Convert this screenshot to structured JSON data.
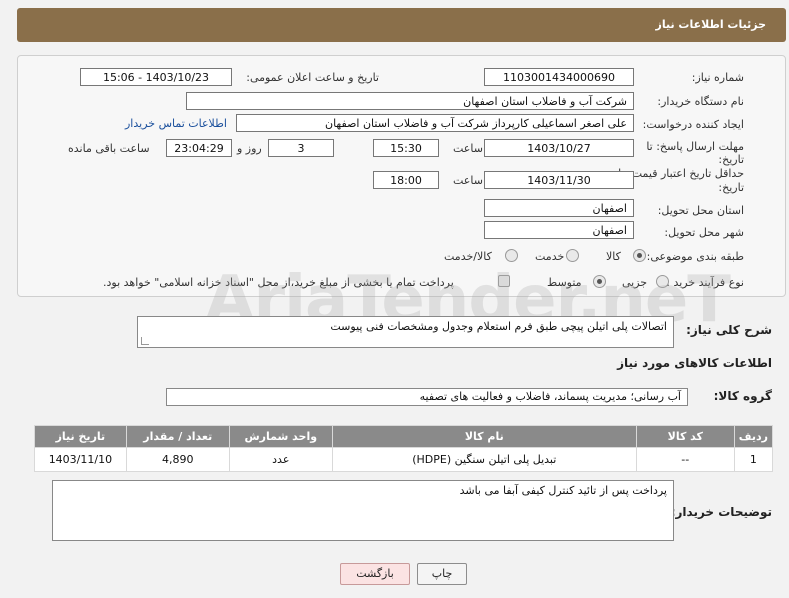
{
  "header": {
    "title": "جزئیات اطلاعات نیاز"
  },
  "form": {
    "need_number_label": "شماره نیاز:",
    "need_number": "1103001434000690",
    "announce_label": "تاریخ و ساعت اعلان عمومی:",
    "announce_value": "1403/10/23 - 15:06",
    "buyer_org_label": "نام دستگاه خریدار:",
    "buyer_org": "شرکت آب و فاضلاب استان اصفهان",
    "creator_label": "ایجاد کننده درخواست:",
    "creator": "علی اصغر اسماعیلی کارپرداز شرکت آب و فاضلاب استان اصفهان",
    "buyer_contact_link": "اطلاعات تماس خریدار",
    "deadline_label_1": "مهلت ارسال پاسخ: تا",
    "deadline_label_2": "تاریخ:",
    "deadline_date": "1403/10/27",
    "time_label": "ساعت",
    "deadline_time": "15:30",
    "days_value": "3",
    "days_and_label": "روز و",
    "remaining_time": "23:04:29",
    "remaining_label": "ساعت باقی مانده",
    "price_valid_label_1": "حداقل تاریخ اعتبار قیمت: تا",
    "price_valid_label_2": "تاریخ:",
    "price_valid_date": "1403/11/30",
    "price_valid_time": "18:00",
    "province_label": "استان محل تحویل:",
    "province": "اصفهان",
    "city_label": "شهر محل تحویل:",
    "city": "اصفهان",
    "category_label": "طبقه بندی موضوعی:",
    "category_options": [
      "کالا",
      "خدمت",
      "کالا/خدمت"
    ],
    "process_label": "نوع فرآیند خرید :",
    "process_options": [
      "جزیی",
      "متوسط"
    ],
    "payment_note": "پرداخت تمام یا بخشی از مبلغ خرید،از محل \"اسناد خزانه اسلامی\" خواهد بود."
  },
  "summary": {
    "label": "شرح کلی نیاز:",
    "text": "اتصالات پلی اتیلن پیچی طبق فرم استعلام وجدول ومشخصات فنی پیوست"
  },
  "goods": {
    "section_title": "اطلاعات کالاهای مورد نیاز",
    "group_label": "گروه کالا:",
    "group_value": "آب رسانی؛ مدیریت پسماند، فاضلاب و فعالیت های تصفیه",
    "columns": [
      "ردیف",
      "کد کالا",
      "نام کالا",
      "واحد شمارش",
      "تعداد / مقدار",
      "تاریخ نیاز"
    ],
    "rows": [
      [
        "1",
        "--",
        "تبدیل پلی اتیلن سنگین (HDPE)",
        "عدد",
        "4,890",
        "1403/11/10"
      ]
    ]
  },
  "buyer_notes": {
    "label": "توضیحات خریدار:",
    "text": "پرداخت پس از تائید کنترل کیفی آبفا می باشد"
  },
  "buttons": {
    "print": "چاپ",
    "back": "بازگشت"
  },
  "watermark": "AriaTender.neT"
}
